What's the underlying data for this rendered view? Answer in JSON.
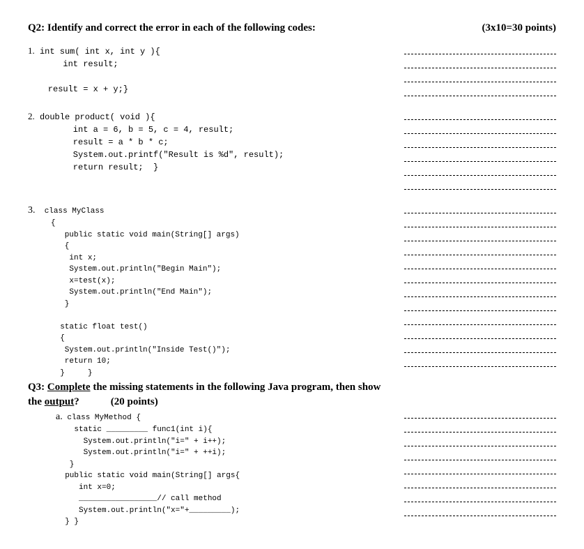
{
  "q2": {
    "title": "Q2: Identify and correct the error in each of the following codes:",
    "points": "(3x10=30 points)"
  },
  "code1": {
    "num": "1.",
    "line1": " int sum( int x, int y ){",
    "line2": "       int result;",
    "line3": "",
    "line4": "    result = x + y;}"
  },
  "code2": {
    "num": "2.",
    "line1": " double product( void ){",
    "line2": "         int a = 6, b = 5, c = 4, result;",
    "line3": "         result = a * b * c;",
    "line4": "         System.out.printf(\"Result is %d\", result);",
    "line5": "         return result;  }"
  },
  "code3": {
    "num": "3.",
    "line1": "  class MyClass",
    "line2": "     {",
    "line3": "        public static void main(String[] args)",
    "line4": "        {",
    "line5": "         int x;",
    "line6": "         System.out.println(\"Begin Main\");",
    "line7": "         x=test(x);",
    "line8": "         System.out.println(\"End Main\");",
    "line9": "        }",
    "line10": "",
    "line11": "       static float test()",
    "line12": "       {",
    "line13": "        System.out.println(\"Inside Test()\");",
    "line14": "        return 10;",
    "line15": "       }     }"
  },
  "q3": {
    "prefix": "Q3: ",
    "underline1": "Complete",
    "mid1": " the missing statements in the following Java program, then show the ",
    "underline2": "output",
    "suffix": "?",
    "points": "(20 points)",
    "num": "a.",
    "line1": " class MyMethod {",
    "line2": "    static _________ func1(int i){",
    "line3": "      System.out.println(\"i=\" + i++);",
    "line4": "      System.out.println(\"i=\" + ++i);",
    "line5": "   }",
    "line6": "  public static void main(String[] args{",
    "line7": "     int x=0;",
    "line8": "     _________________// call method",
    "line9": "     System.out.println(\"x=\"+_________);",
    "line10": "  } }"
  }
}
